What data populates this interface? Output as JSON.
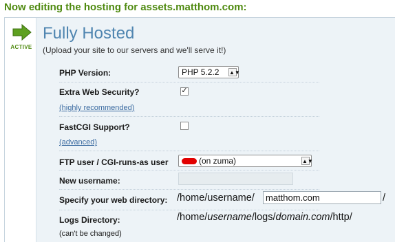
{
  "header": {
    "title": "Now editing the hosting for assets.matthom.com:"
  },
  "plan": {
    "status": "ACTIVE",
    "status_icon": "green-arrow-icon",
    "title": "Fully Hosted",
    "subtitle": "(Upload your site to our servers and we'll serve it!)"
  },
  "php": {
    "label": "PHP Version:",
    "selected": "PHP 5.2.2"
  },
  "security": {
    "label": "Extra Web Security?",
    "link": "(highly recommended)",
    "checked": true,
    "mark": "✓"
  },
  "fastcgi": {
    "label": "FastCGI Support?",
    "link": "(advanced)",
    "checked": false
  },
  "ftp": {
    "label": "FTP user / CGI-runs-as user",
    "selected_suffix": "(on zuma)"
  },
  "new_username": {
    "label": "New username:",
    "value": ""
  },
  "web_dir": {
    "label": "Specify your web directory:",
    "prefix": "/home/username/",
    "value": "matthom.com",
    "suffix": "/"
  },
  "logs": {
    "label": "Logs Directory:",
    "path_home": "/home/",
    "path_user": "username",
    "path_logs": "/logs/",
    "path_domain": "domain.com",
    "path_end": "/http/",
    "note": "(can't be changed)"
  },
  "colors": {
    "accent_green": "#4f8a10",
    "title_blue": "#4f85b0",
    "link_blue": "#3a6aa0",
    "panel_bg": "#edf3f7",
    "redaction": "#e20000"
  }
}
